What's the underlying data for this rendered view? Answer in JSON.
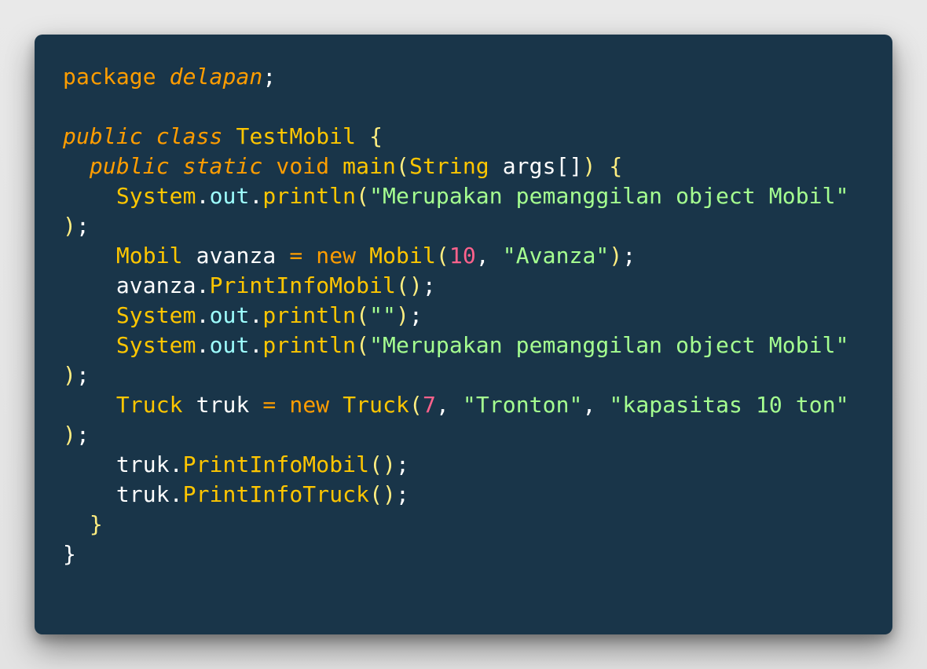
{
  "code": {
    "language": "java",
    "lines": [
      [
        {
          "t": "package",
          "k": "kw"
        },
        {
          "t": " ",
          "k": "pun"
        },
        {
          "t": "delapan",
          "k": "kw it"
        },
        {
          "t": ";",
          "k": "pun"
        }
      ],
      [],
      [
        {
          "t": "public",
          "k": "kw it"
        },
        {
          "t": " ",
          "k": "pun"
        },
        {
          "t": "class",
          "k": "kw it"
        },
        {
          "t": " ",
          "k": "pun"
        },
        {
          "t": "TestMobil",
          "k": "ty"
        },
        {
          "t": " ",
          "k": "pun"
        },
        {
          "t": "{",
          "k": "par"
        }
      ],
      [
        {
          "t": "  ",
          "k": "pun"
        },
        {
          "t": "public",
          "k": "kw it"
        },
        {
          "t": " ",
          "k": "pun"
        },
        {
          "t": "static",
          "k": "kw it"
        },
        {
          "t": " ",
          "k": "pun"
        },
        {
          "t": "void",
          "k": "kw"
        },
        {
          "t": " ",
          "k": "pun"
        },
        {
          "t": "main",
          "k": "fn"
        },
        {
          "t": "(",
          "k": "par"
        },
        {
          "t": "String",
          "k": "ty"
        },
        {
          "t": " ",
          "k": "pun"
        },
        {
          "t": "args",
          "k": "id"
        },
        {
          "t": "[]",
          "k": "pun"
        },
        {
          "t": ")",
          "k": "par"
        },
        {
          "t": " ",
          "k": "pun"
        },
        {
          "t": "{",
          "k": "par"
        }
      ],
      [
        {
          "t": "    ",
          "k": "pun"
        },
        {
          "t": "System",
          "k": "ty"
        },
        {
          "t": ".",
          "k": "pun"
        },
        {
          "t": "out",
          "k": "prop"
        },
        {
          "t": ".",
          "k": "pun"
        },
        {
          "t": "println",
          "k": "fn"
        },
        {
          "t": "(",
          "k": "par"
        },
        {
          "t": "\"Merupakan pemanggilan object Mobil\"",
          "k": "str"
        }
      ],
      [
        {
          "t": ")",
          "k": "par"
        },
        {
          "t": ";",
          "k": "pun"
        }
      ],
      [
        {
          "t": "    ",
          "k": "pun"
        },
        {
          "t": "Mobil",
          "k": "ty"
        },
        {
          "t": " ",
          "k": "pun"
        },
        {
          "t": "avanza",
          "k": "id"
        },
        {
          "t": " ",
          "k": "pun"
        },
        {
          "t": "=",
          "k": "op"
        },
        {
          "t": " ",
          "k": "pun"
        },
        {
          "t": "new",
          "k": "kw"
        },
        {
          "t": " ",
          "k": "pun"
        },
        {
          "t": "Mobil",
          "k": "fn"
        },
        {
          "t": "(",
          "k": "par"
        },
        {
          "t": "10",
          "k": "num"
        },
        {
          "t": ",",
          "k": "pun"
        },
        {
          "t": " ",
          "k": "pun"
        },
        {
          "t": "\"Avanza\"",
          "k": "str"
        },
        {
          "t": ")",
          "k": "par"
        },
        {
          "t": ";",
          "k": "pun"
        }
      ],
      [
        {
          "t": "    ",
          "k": "pun"
        },
        {
          "t": "avanza",
          "k": "id"
        },
        {
          "t": ".",
          "k": "pun"
        },
        {
          "t": "PrintInfoMobil",
          "k": "fn"
        },
        {
          "t": "()",
          "k": "par"
        },
        {
          "t": ";",
          "k": "pun"
        }
      ],
      [
        {
          "t": "    ",
          "k": "pun"
        },
        {
          "t": "System",
          "k": "ty"
        },
        {
          "t": ".",
          "k": "pun"
        },
        {
          "t": "out",
          "k": "prop"
        },
        {
          "t": ".",
          "k": "pun"
        },
        {
          "t": "println",
          "k": "fn"
        },
        {
          "t": "(",
          "k": "par"
        },
        {
          "t": "\"\"",
          "k": "str"
        },
        {
          "t": ")",
          "k": "par"
        },
        {
          "t": ";",
          "k": "pun"
        }
      ],
      [
        {
          "t": "    ",
          "k": "pun"
        },
        {
          "t": "System",
          "k": "ty"
        },
        {
          "t": ".",
          "k": "pun"
        },
        {
          "t": "out",
          "k": "prop"
        },
        {
          "t": ".",
          "k": "pun"
        },
        {
          "t": "println",
          "k": "fn"
        },
        {
          "t": "(",
          "k": "par"
        },
        {
          "t": "\"Merupakan pemanggilan object Mobil\"",
          "k": "str"
        }
      ],
      [
        {
          "t": ")",
          "k": "par"
        },
        {
          "t": ";",
          "k": "pun"
        }
      ],
      [
        {
          "t": "    ",
          "k": "pun"
        },
        {
          "t": "Truck",
          "k": "ty"
        },
        {
          "t": " ",
          "k": "pun"
        },
        {
          "t": "truk",
          "k": "id"
        },
        {
          "t": " ",
          "k": "pun"
        },
        {
          "t": "=",
          "k": "op"
        },
        {
          "t": " ",
          "k": "pun"
        },
        {
          "t": "new",
          "k": "kw"
        },
        {
          "t": " ",
          "k": "pun"
        },
        {
          "t": "Truck",
          "k": "fn"
        },
        {
          "t": "(",
          "k": "par"
        },
        {
          "t": "7",
          "k": "num"
        },
        {
          "t": ",",
          "k": "pun"
        },
        {
          "t": " ",
          "k": "pun"
        },
        {
          "t": "\"Tronton\"",
          "k": "str"
        },
        {
          "t": ",",
          "k": "pun"
        },
        {
          "t": " ",
          "k": "pun"
        },
        {
          "t": "\"kapasitas 10 ton\"",
          "k": "str"
        }
      ],
      [
        {
          "t": ")",
          "k": "par"
        },
        {
          "t": ";",
          "k": "pun"
        }
      ],
      [
        {
          "t": "    ",
          "k": "pun"
        },
        {
          "t": "truk",
          "k": "id"
        },
        {
          "t": ".",
          "k": "pun"
        },
        {
          "t": "PrintInfoMobil",
          "k": "fn"
        },
        {
          "t": "()",
          "k": "par"
        },
        {
          "t": ";",
          "k": "pun"
        }
      ],
      [
        {
          "t": "    ",
          "k": "pun"
        },
        {
          "t": "truk",
          "k": "id"
        },
        {
          "t": ".",
          "k": "pun"
        },
        {
          "t": "PrintInfoTruck",
          "k": "fn"
        },
        {
          "t": "()",
          "k": "par"
        },
        {
          "t": ";",
          "k": "pun"
        }
      ],
      [
        {
          "t": "  ",
          "k": "pun"
        },
        {
          "t": "}",
          "k": "par"
        }
      ],
      [
        {
          "t": "}",
          "k": "pun"
        }
      ]
    ]
  },
  "colors": {
    "background": "#e6e6e6",
    "card": "#193549",
    "keyword": "#ff9d00",
    "type": "#ffc600",
    "string": "#a5ff90",
    "number": "#ff628c",
    "property": "#9effff",
    "text": "#ffffff"
  }
}
